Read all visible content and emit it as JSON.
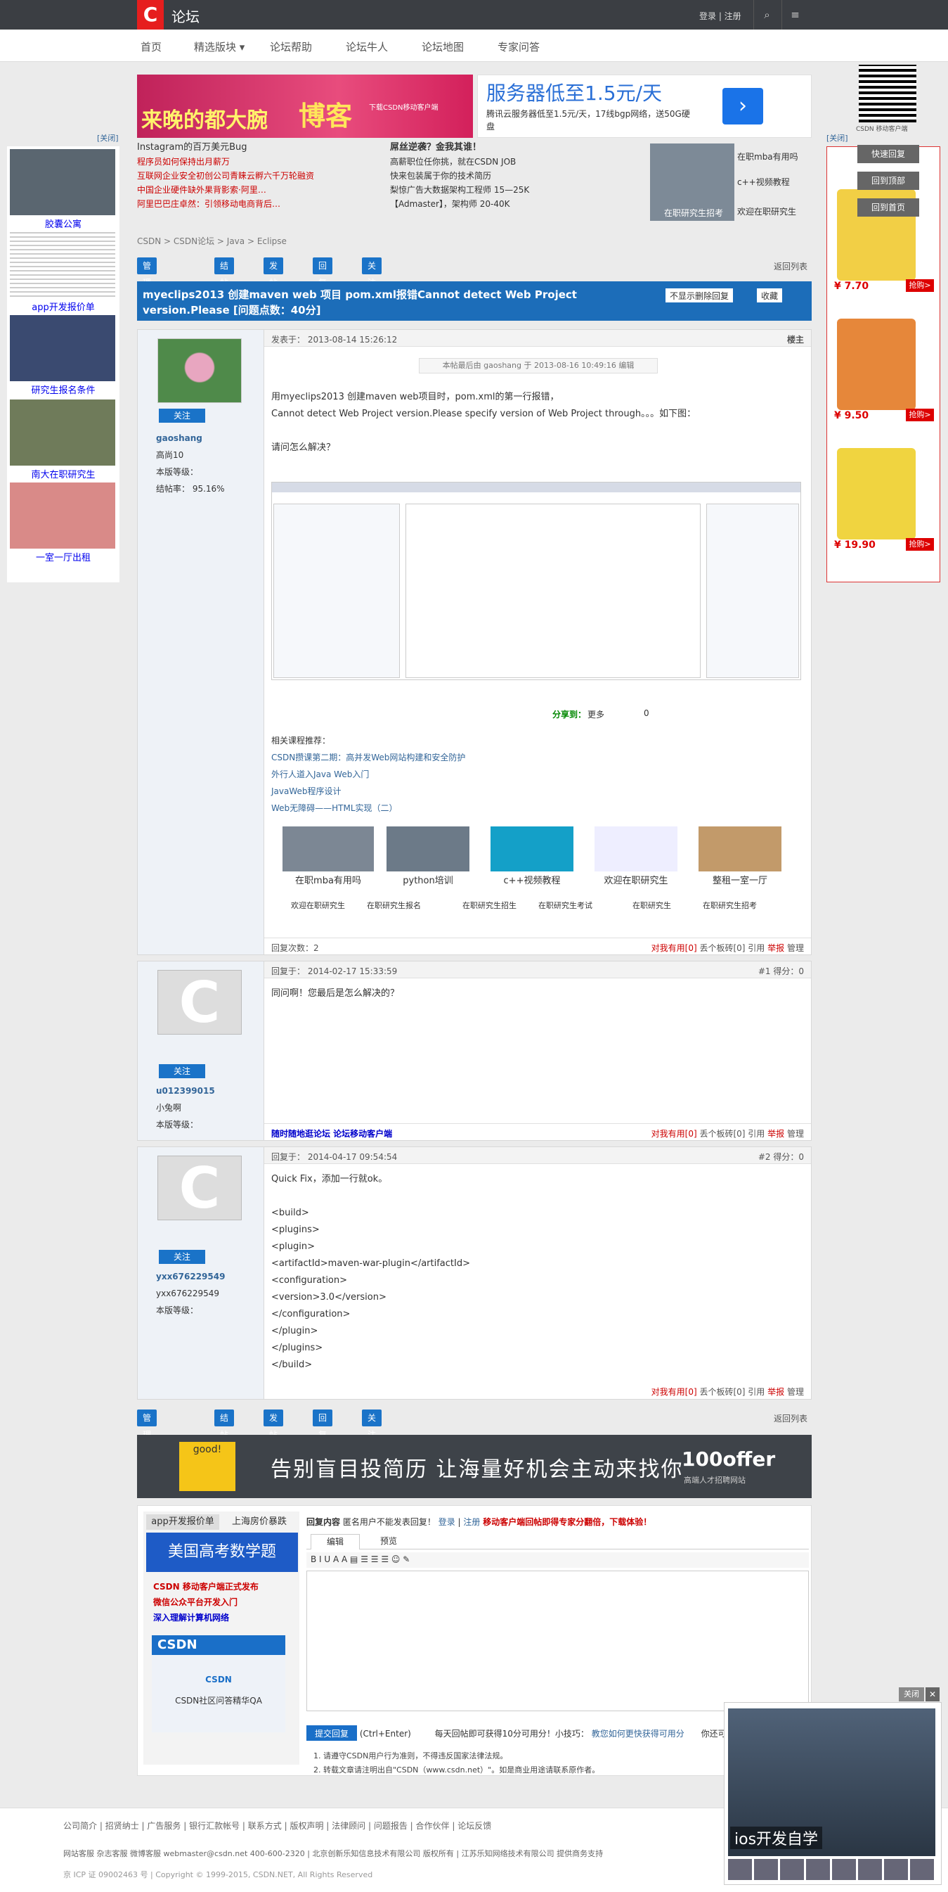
{
  "topbar": {
    "logo": "C",
    "title": "论坛",
    "login": "登录 | 注册",
    "search_icon": "search-icon",
    "menu_icon": "menu-icon"
  },
  "nav": [
    "首页",
    "精选版块 ▾",
    "论坛帮助",
    "论坛牛人",
    "论坛地图",
    "专家问答"
  ],
  "ads": {
    "ad1_line1": "来晚的都大腕",
    "ad1_line2": "博客",
    "ad1_small": "下载CSDN移动客户端",
    "ad2_head": "服务器低至1.5元/天",
    "ad2_text": "腾讯云服务器低至1.5元/天，17线bgp网络，送50G硬盘",
    "ad2_btn": "›"
  },
  "links": {
    "col1": [
      "Instagram的百万美元Bug",
      "程序员如何保持出月薪万",
      "互联网企业安全初创公司青睐云孵六千万轮融资",
      "中国企业硬件缺外果背影索·阿里…",
      "阿里巴巴庄卓然：引领移动电商背后…"
    ],
    "col2": [
      "屌丝逆袭？金我其谁！",
      "高薪职位任你挑，就在CSDN JOB",
      "快来包装属于你的技术简历",
      "梨惊广告大数据架构工程师 15—25K",
      "【Admaster】，架构师 20-40K"
    ],
    "img_labels": [
      "在职mba有用吗",
      "c++视频教程",
      "在职研究生招考",
      "欢迎在职研究生"
    ]
  },
  "breadcrumb": "CSDN > CSDN论坛 > Java > Eclipse",
  "toolbar": {
    "manage": "管理菜单 ▾",
    "close": "结帖",
    "post": "发帖",
    "reply": "回复",
    "follow": "关注",
    "back": "返回列表"
  },
  "thread": {
    "title": "myeclips2013 创建maven web 项目 pom.xml报错Cannot detect Web Project version.Please [问题点数：40分]",
    "noshow": "不显示删除回复",
    "fav": "收藏"
  },
  "post1": {
    "time": "发表于： 2013-08-14 15:26:12",
    "role": "楼主",
    "edited": "本帖最后由 gaoshang 于 2013-08-16 10:49:16 编辑",
    "user": "gaoshang",
    "level": "高尚10",
    "rank_label": "本版等级：",
    "rate": "结帖率： 95.16%",
    "follow": "关注",
    "body": [
      "用myeclips2013 创建maven web项目时，pom.xml的第一行报错，",
      "Cannot detect Web Project version.Please specify version of Web Project through。。。如下图：",
      "",
      "请问怎么解决？"
    ],
    "share": "分享到：",
    "more": "更多",
    "share_count": "0",
    "course_title": "相关课程推荐：",
    "courses": [
      "CSDN攒课第二期：高并发Web网站构建和安全防护",
      "外行人道入Java Web入门",
      "JavaWeb程序设计",
      "Web无障碍——HTML实现（二）"
    ],
    "thumbs": [
      "在职mba有用吗",
      "python培训",
      "c++视频教程",
      "欢迎在职研究生",
      "整租一室一厅"
    ],
    "tags": [
      "欢迎在职研究生",
      "在职研究生报名",
      "在职研究生招生",
      "在职研究生考试",
      "在职研究生",
      "在职研究生招考"
    ],
    "reply_count": "回复次数：2",
    "actions": [
      "对我有用[0]",
      "丢个板砖[0]",
      "引用",
      "举报",
      "管理"
    ]
  },
  "post2": {
    "time": "回复于： 2014-02-17 15:33:59",
    "floor": "#1 得分：0",
    "user": "u012399015",
    "nick": "小兔啊",
    "rank_label": "本版等级：",
    "follow": "关注",
    "body": "同问啊！您最后是怎么解决的？",
    "mobile": "随时随地逛论坛 论坛移动客户端",
    "actions": [
      "对我有用[0]",
      "丢个板砖[0]",
      "引用",
      "举报",
      "管理"
    ]
  },
  "post3": {
    "time": "回复于： 2014-04-17 09:54:54",
    "floor": "#2 得分：0",
    "user": "yxx676229549",
    "nick": "yxx676229549",
    "rank_label": "本版等级：",
    "follow": "关注",
    "body": [
      "Quick Fix，添加一行就ok。",
      "",
      "<build>",
      "<plugins>",
      "<plugin>",
      "<artifactId>maven-war-plugin</artifactId>",
      "<configuration>",
      "<version>3.0</version>",
      "</configuration>",
      "</plugin>",
      "</plugins>",
      "</build>"
    ],
    "actions": [
      "对我有用[0]",
      "丢个板砖[0]",
      "引用",
      "举报",
      "管理"
    ]
  },
  "banner": {
    "good": "good!",
    "text": "告别盲目投简历 让海量好机会主动来找你",
    "brand": "100offer",
    "sub": "高端人才招聘网站"
  },
  "editor": {
    "tabs_left": [
      "app开发报价单",
      "上海房价暴跌"
    ],
    "promo": "美国高考数学题",
    "promo_links": [
      "CSDN 移动客户端正式发布",
      "微信公众平台开发入门",
      "深入理解计算机网络"
    ],
    "csdn_logo": "CSDN",
    "csdn_sub1": "CSDN",
    "csdn_sub2": "CSDN社区问答精华QA",
    "reply_label": "回复内容",
    "reply_hint": "匿名用户不能发表回复！",
    "login": "登录",
    "register": "注册",
    "notice": "移动客户端回帖即得专家分翻倍，下载体验！",
    "tab_edit": "编辑",
    "tab_preview": "预览",
    "submit": "提交回复",
    "ctrl": "(Ctrl+Enter)",
    "tip": "每天回帖即可获得10分可用分！小技巧：",
    "tip_link": "教您如何更快获得可用分",
    "tip_end": "你还可",
    "rules": [
      "1. 请遵守CSDN用户行为准则，不得违反国家法律法规。",
      "2. 转载文章请注明出自\"CSDN（www.csdn.net）\"。如是商业用途请联系原作者。"
    ]
  },
  "left_ads": [
    "胶囊公寓",
    "app开发报价单",
    "研究生报名条件",
    "南大在职研究生",
    "一室一厅出租"
  ],
  "close_label": "[关闭]",
  "right_ads": {
    "prices": [
      "¥ 7.70",
      "¥ 9.50",
      "¥ 19.90"
    ],
    "buy": "抢购>"
  },
  "right_float": {
    "qr_caption": "CSDN 移动客户端",
    "btns": [
      "快速回复",
      "回到顶部",
      "回到首页"
    ]
  },
  "popup": {
    "close": "关闭",
    "label": "ios开发自学"
  },
  "footer": {
    "links": [
      "公司简介",
      "招贤纳士",
      "广告服务",
      "银行汇款帐号",
      "联系方式",
      "版权声明",
      "法律顾问",
      "问题报告",
      "合作伙伴",
      "论坛反馈"
    ],
    "contacts": "网站客服  杂志客服  微博客服  webmaster@csdn.net  400-600-2320 | 北京创新乐知信息技术有限公司 版权所有 | 江苏乐知网络技术有限公司 提供商务支持",
    "icp": "京 ICP 证 09002463 号 | Copyright © 1999-2015, CSDN.NET, All Rights Reserved"
  },
  "colors": {
    "brand_red": "#e61e1e",
    "topbar": "#3b3e43",
    "accent_blue": "#1c6db9"
  }
}
